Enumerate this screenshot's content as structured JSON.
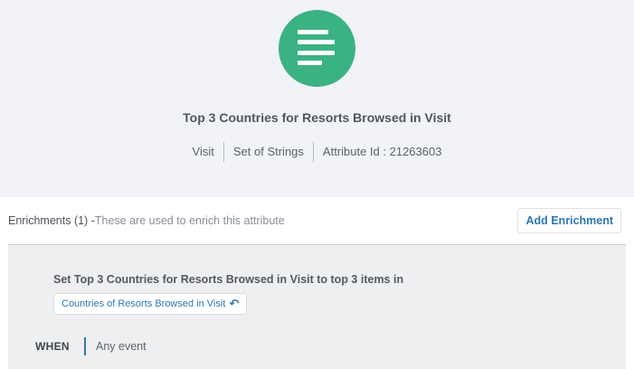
{
  "attribute": {
    "title": "Top 3 Countries for Resorts Browsed in Visit",
    "scope": "Visit",
    "type": "Set of Strings",
    "id_label": "Attribute Id : 21263603",
    "icon": "attribute-list-icon",
    "accent_color": "#3bb282"
  },
  "enrichments": {
    "heading": "Enrichments (1) -",
    "description": "These are used to enrich this attribute",
    "add_button": "Add Enrichment"
  },
  "enrichment_item": {
    "rule_text": "Set Top 3 Countries for Resorts Browsed in Visit to top 3 items in",
    "source_chip": "Countries of Resorts Browsed in Visit",
    "source_icon": "undo-arrow-icon",
    "when_label": "WHEN",
    "when_value": "Any event"
  },
  "colors": {
    "link": "#2d77b4",
    "header_bg": "#f1f3f8"
  }
}
